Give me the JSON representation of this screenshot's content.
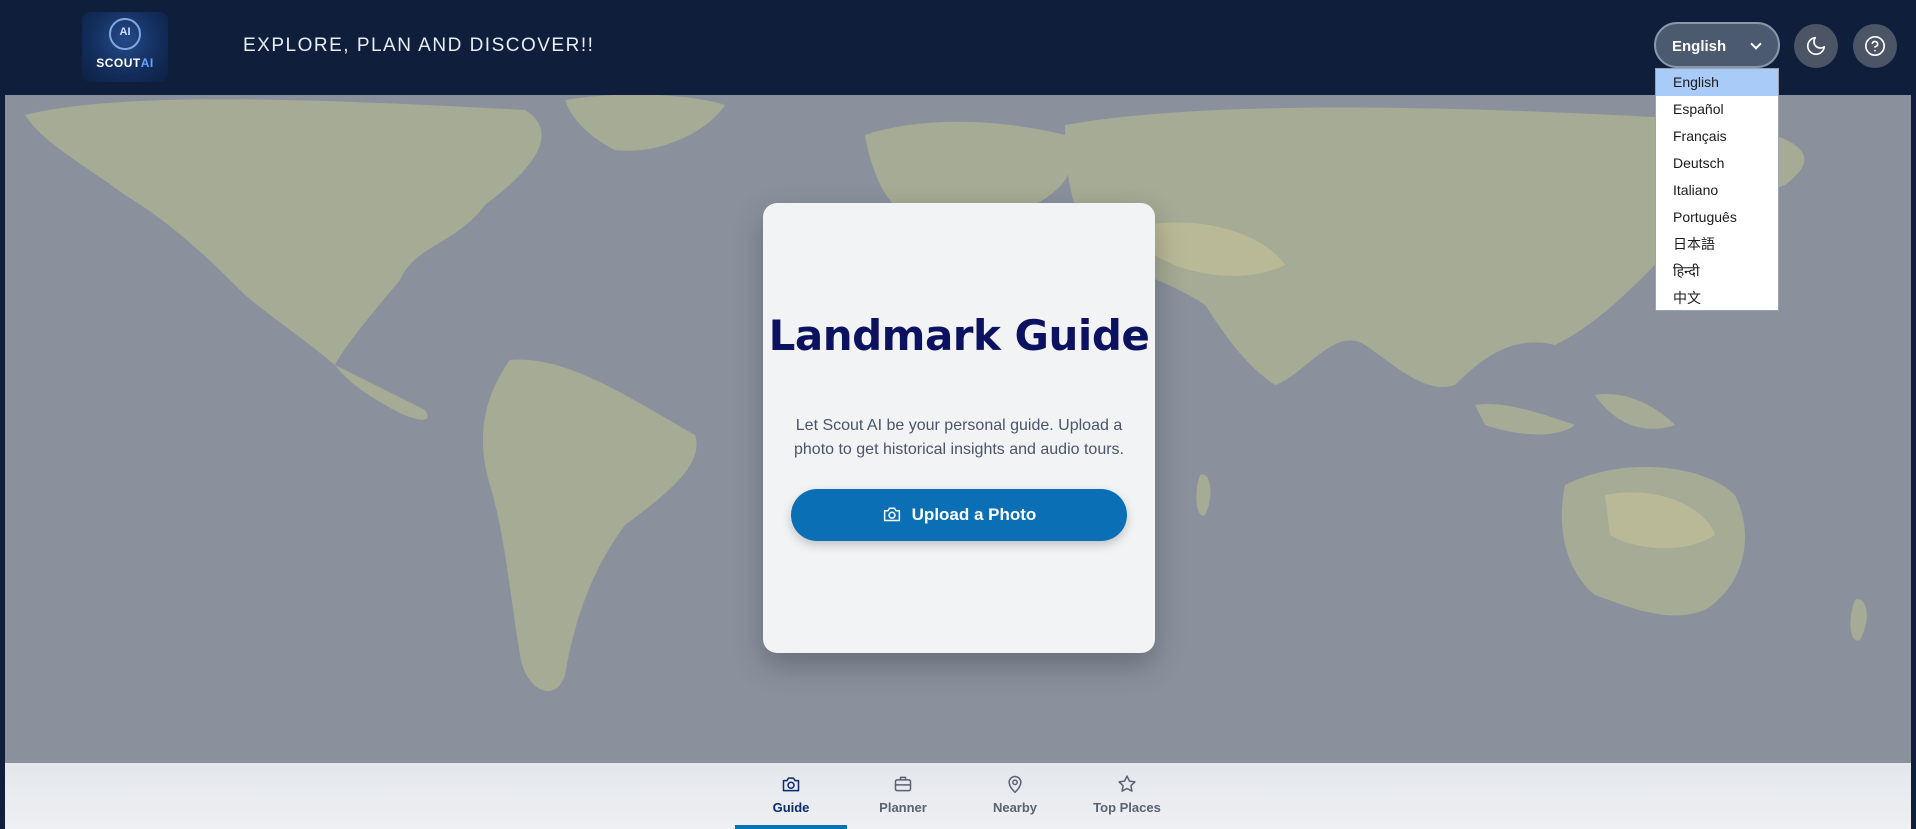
{
  "header": {
    "logo_text_primary": "SCOUT",
    "logo_text_accent": "AI",
    "logo_badge": "AI",
    "tagline": "EXPLORE, PLAN AND DISCOVER!!",
    "language_selected": "English",
    "icons": {
      "theme": "moon-icon",
      "help": "question-icon",
      "dropdown": "chevron-down-icon"
    }
  },
  "language_options": [
    "English",
    "Español",
    "Français",
    "Deutsch",
    "Italiano",
    "Português",
    "日本語",
    "हिन्दी",
    "中文"
  ],
  "card": {
    "title": "Landmark Guide",
    "description": "Let Scout AI be your personal guide. Upload a photo to get historical insights and audio tours.",
    "upload_button": "Upload a Photo"
  },
  "bottom_nav": {
    "active": "Guide",
    "items": [
      {
        "label": "Guide",
        "icon": "camera-icon"
      },
      {
        "label": "Planner",
        "icon": "briefcase-icon"
      },
      {
        "label": "Nearby",
        "icon": "map-pin-icon"
      },
      {
        "label": "Top Places",
        "icon": "star-icon"
      }
    ]
  },
  "colors": {
    "header_bg": "#0f1f3b",
    "accent": "#0a6fb5",
    "title": "#0c1160",
    "dropdown_selected": "#a8cbf7"
  }
}
